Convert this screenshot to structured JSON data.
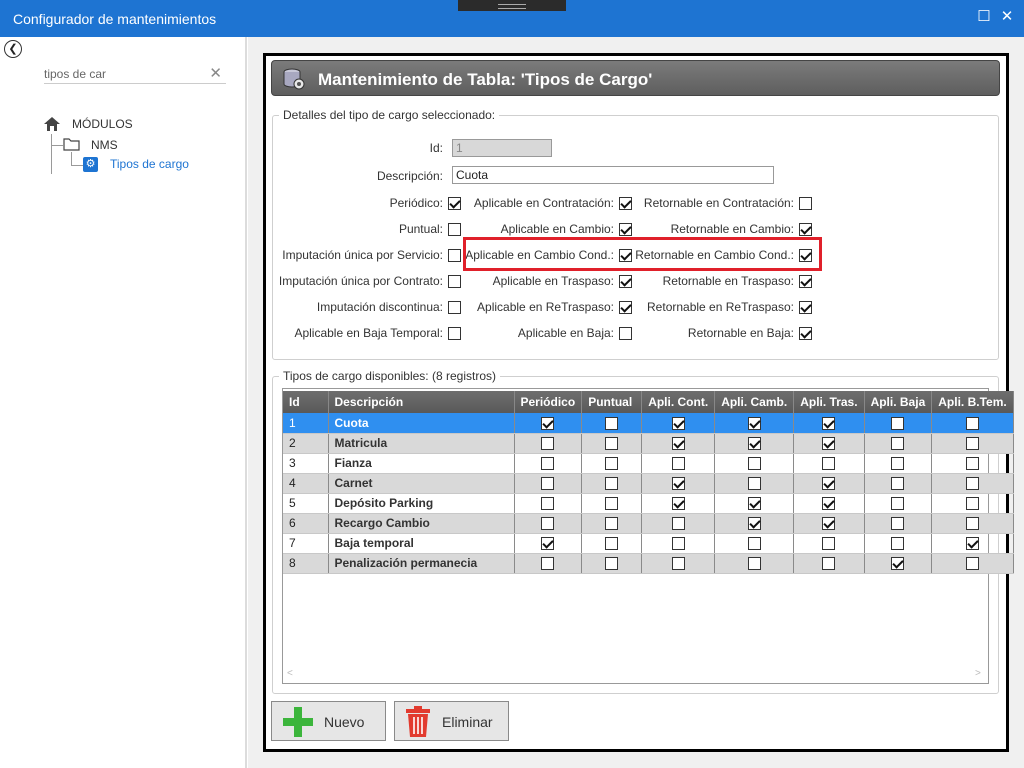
{
  "window": {
    "title": "Configurador de mantenimientos"
  },
  "sidebar": {
    "search_value": "tipos de car",
    "tree": {
      "root": "MÓDULOS",
      "group": "NMS",
      "leaf": "Tipos de cargo"
    }
  },
  "header": {
    "title": "Mantenimiento de Tabla: 'Tipos de Cargo'"
  },
  "details": {
    "legend": "Detalles del tipo de cargo seleccionado:",
    "id_label": "Id:",
    "id_value": "1",
    "desc_label": "Descripción:",
    "desc_value": "Cuota",
    "col1": [
      {
        "label": "Periódico:",
        "checked": true
      },
      {
        "label": "Puntual:",
        "checked": false
      },
      {
        "label": "Imputación única por Servicio:",
        "checked": false
      },
      {
        "label": "Imputación única por Contrato:",
        "checked": false
      },
      {
        "label": "Imputación discontinua:",
        "checked": false
      },
      {
        "label": "Aplicable en Baja Temporal:",
        "checked": false
      }
    ],
    "col2": [
      {
        "label": "Aplicable en Contratación:",
        "checked": true
      },
      {
        "label": "Aplicable en Cambio:",
        "checked": true
      },
      {
        "label": "Aplicable en Cambio Cond.:",
        "checked": true
      },
      {
        "label": "Aplicable en Traspaso:",
        "checked": true
      },
      {
        "label": "Aplicable en ReTraspaso:",
        "checked": true
      },
      {
        "label": "Aplicable en Baja:",
        "checked": false
      }
    ],
    "col3": [
      {
        "label": "Retornable en Contratación:",
        "checked": false
      },
      {
        "label": "Retornable en Cambio:",
        "checked": true
      },
      {
        "label": "Retornable en Cambio Cond.:",
        "checked": true
      },
      {
        "label": "Retornable en Traspaso:",
        "checked": true
      },
      {
        "label": "Retornable en ReTraspaso:",
        "checked": true
      },
      {
        "label": "Retornable en Baja:",
        "checked": true
      }
    ]
  },
  "grid": {
    "legend": "Tipos de cargo disponibles:  (8 registros)",
    "columns": [
      "Id",
      "Descripción",
      "Periódico",
      "Puntual",
      "Apli. Cont.",
      "Apli. Camb.",
      "Apli. Tras.",
      "Apli. Baja",
      "Apli. B.Tem."
    ],
    "rows": [
      {
        "id": "1",
        "desc": "Cuota",
        "flags": [
          true,
          false,
          true,
          true,
          true,
          false,
          false
        ]
      },
      {
        "id": "2",
        "desc": "Matricula",
        "flags": [
          false,
          false,
          true,
          true,
          true,
          false,
          false
        ]
      },
      {
        "id": "3",
        "desc": "Fianza",
        "flags": [
          false,
          false,
          false,
          false,
          false,
          false,
          false
        ]
      },
      {
        "id": "4",
        "desc": "Carnet",
        "flags": [
          false,
          false,
          true,
          false,
          true,
          false,
          false
        ]
      },
      {
        "id": "5",
        "desc": "Depósito Parking",
        "flags": [
          false,
          false,
          true,
          true,
          true,
          false,
          false
        ]
      },
      {
        "id": "6",
        "desc": "Recargo Cambio",
        "flags": [
          false,
          false,
          false,
          true,
          true,
          false,
          false
        ]
      },
      {
        "id": "7",
        "desc": "Baja temporal",
        "flags": [
          true,
          false,
          false,
          false,
          false,
          false,
          true
        ]
      },
      {
        "id": "8",
        "desc": "Penalización permanecia",
        "flags": [
          false,
          false,
          false,
          false,
          false,
          true,
          false
        ]
      }
    ]
  },
  "buttons": {
    "new": "Nuevo",
    "delete": "Eliminar"
  },
  "colors": {
    "accent": "#1e74d2",
    "selection": "#2f8ff0",
    "highlight": "#e0202a"
  }
}
